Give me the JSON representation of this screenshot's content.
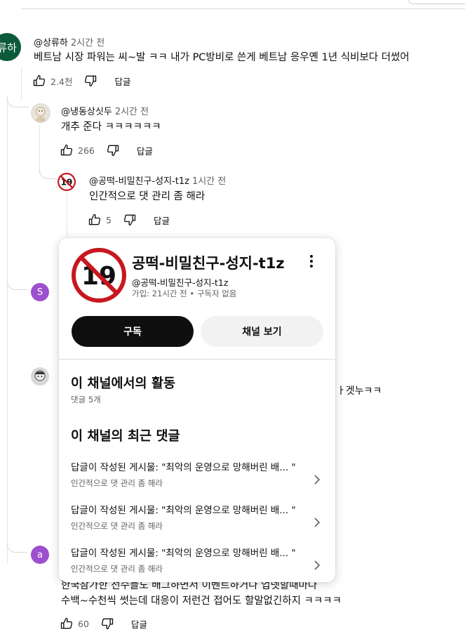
{
  "comments": [
    {
      "avatar_text": "류하",
      "avatar_color": "#0b5a3a",
      "author": "@상류하",
      "time": "2시간 전",
      "text": "베트남 시장 파워는 씨~발 ㅋㅋ 내가 PC방비로 쓴게 베트남 응우옌 1년 식비보다 더썼어",
      "likes": "2.4천",
      "reply": "답글"
    },
    {
      "author": "@냉동상싯두",
      "time": "2시간 전",
      "text": "개추 준다 ㅋㅋㅋㅋㅋㅋ",
      "likes": "266",
      "reply": "답글"
    },
    {
      "author": "@공떡-비밀친구-성지-t1z",
      "time": "1시간 전",
      "text": "인간적으로 댓 관리 좀 해라",
      "likes": "5",
      "reply": "답글"
    }
  ],
  "hidden_rows": [
    {
      "avatar_text": "S",
      "avatar_color": "#9c4fcf"
    },
    {
      "partial_text": "ㅏ겟누ㅋㅋ"
    },
    {
      "avatar_text": "a",
      "avatar_color": "#9c4fcf",
      "text_line1": "한국참가한 선수들도 배그하면서 이벤트하거나 업뎃할때마다",
      "text_line2": "수백~수천씩 썻는데 대응이 저런건 접어도 할말없긴하지 ㅋㅋㅋㅋ",
      "likes": "60",
      "reply": "답글"
    }
  ],
  "channel_card": {
    "badge_text": "19",
    "title": "공떡-비밀친구-성지-t1z",
    "handle": "@공떡-비밀친구-성지-t1z",
    "meta": "가입: 21시간 전 • 구독자 없음",
    "subscribe_label": "구독",
    "view_channel_label": "채널 보기",
    "activity_heading": "이 채널에서의 활동",
    "activity_count": "댓글 5개",
    "recent_heading": "이 채널의 최근 댓글",
    "recent": [
      {
        "title": "답글이 작성된 게시물: \"최악의 운영으로 망해버린 배... \"",
        "snippet": "인간적으로 댓 관리 좀 해라"
      },
      {
        "title": "답글이 작성된 게시물: \"최악의 운영으로 망해버린 배... \"",
        "snippet": "인간적으로 댓 관리 좀 해라"
      },
      {
        "title": "답글이 작성된 게시물: \"최악의 운영으로 망해버린 배... \"",
        "snippet": "인간적으로 댓 관리 좀 해라"
      }
    ]
  }
}
